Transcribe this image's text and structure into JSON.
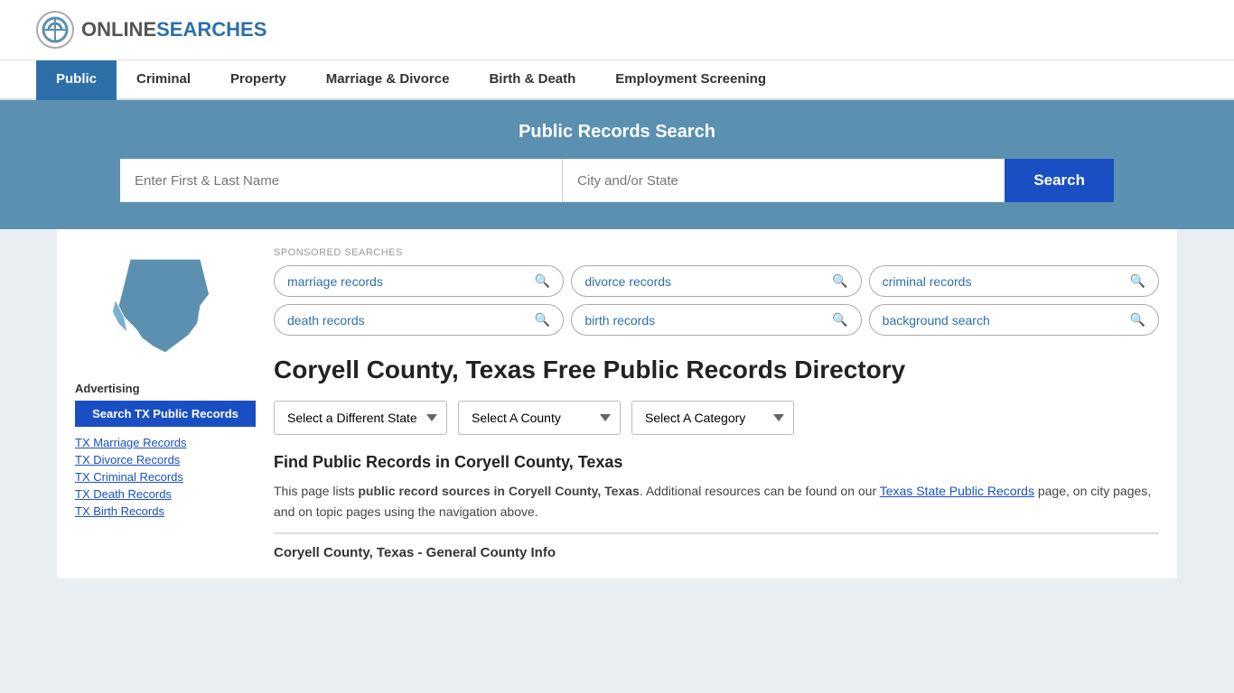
{
  "logo": {
    "online": "ONLINE",
    "searches": "SEARCHES",
    "icon_alt": "OnlineSearches logo"
  },
  "nav": {
    "items": [
      {
        "label": "Public",
        "active": true
      },
      {
        "label": "Criminal",
        "active": false
      },
      {
        "label": "Property",
        "active": false
      },
      {
        "label": "Marriage & Divorce",
        "active": false
      },
      {
        "label": "Birth & Death",
        "active": false
      },
      {
        "label": "Employment Screening",
        "active": false
      }
    ]
  },
  "search_banner": {
    "title": "Public Records Search",
    "name_placeholder": "Enter First & Last Name",
    "location_placeholder": "City and/or State",
    "button_label": "Search"
  },
  "sponsored": {
    "label": "SPONSORED SEARCHES",
    "tags": [
      {
        "label": "marriage records"
      },
      {
        "label": "divorce records"
      },
      {
        "label": "criminal records"
      },
      {
        "label": "death records"
      },
      {
        "label": "birth records"
      },
      {
        "label": "background search"
      }
    ]
  },
  "page": {
    "title": "Coryell County, Texas Free Public Records Directory",
    "dropdowns": {
      "state": "Select a Different State",
      "county": "Select A County",
      "category": "Select A Category"
    }
  },
  "find_records": {
    "heading": "Find Public Records in Coryell County, Texas",
    "description_1": "This page lists ",
    "description_bold": "public record sources in Coryell County, Texas",
    "description_2": ". Additional resources can be found on our ",
    "link_text": "Texas State Public Records",
    "description_3": " page, on city pages, and on topic pages using the navigation above.",
    "county_info_heading": "Coryell County, Texas - General County Info"
  },
  "sidebar": {
    "advertising_label": "Advertising",
    "search_tx_btn": "Search TX Public Records",
    "links": [
      {
        "label": "TX Marriage Records"
      },
      {
        "label": "TX Divorce Records"
      },
      {
        "label": "TX Criminal Records"
      },
      {
        "label": "TX Death Records"
      },
      {
        "label": "TX Birth Records"
      }
    ]
  },
  "colors": {
    "nav_active_bg": "#2d6fa8",
    "banner_bg": "#5b90b0",
    "search_btn_bg": "#1a4fc4",
    "tag_text": "#2d6fa8",
    "link_color": "#1a4fc4"
  }
}
